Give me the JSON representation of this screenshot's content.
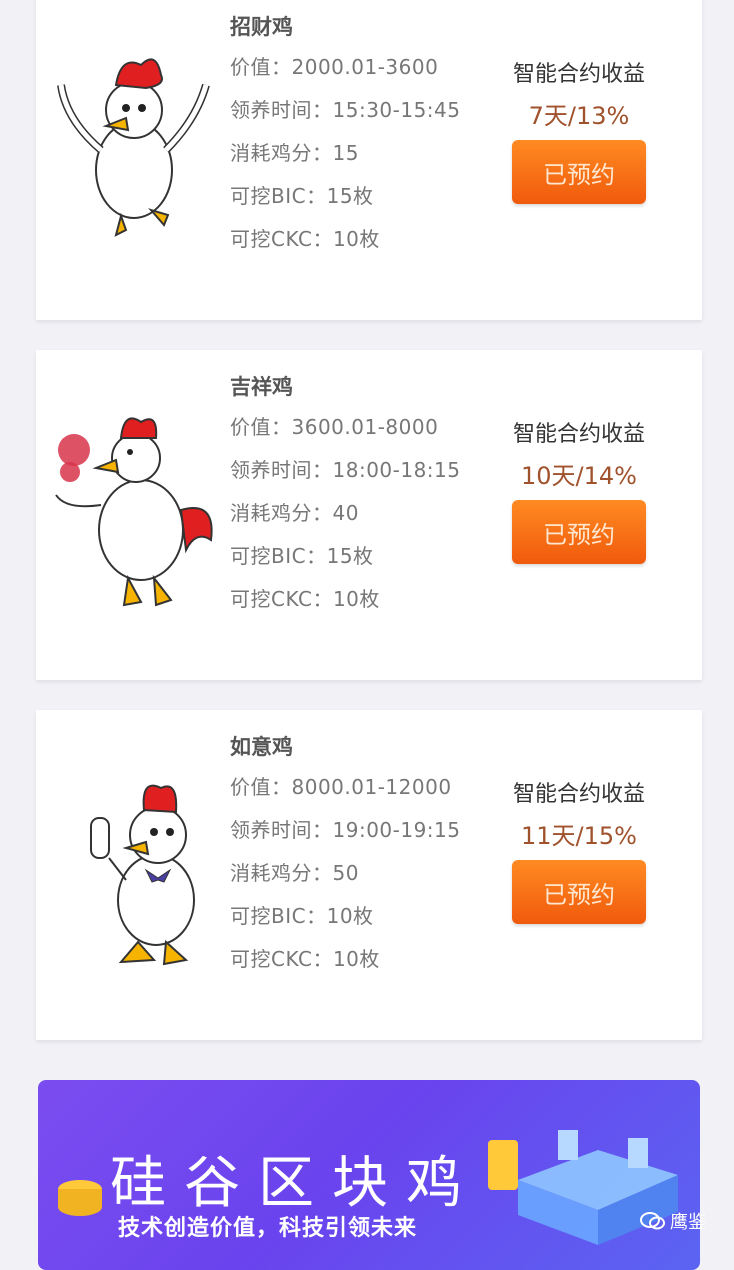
{
  "products": [
    {
      "name": "招财鸡",
      "value_label": "价值：",
      "value": "2000.01-3600",
      "adopt_label": "领养时间：",
      "adopt_time": "15:30-15:45",
      "points_label": "消耗鸡分：",
      "points": "15",
      "bic_label": "可挖BIC：",
      "bic": "15枚",
      "ckc_label": "可挖CKC：",
      "ckc": "10枚",
      "contract_label": "智能合约收益",
      "term": "7天/13%",
      "button_label": "已预约"
    },
    {
      "name": "吉祥鸡",
      "value_label": "价值：",
      "value": "3600.01-8000",
      "adopt_label": "领养时间：",
      "adopt_time": "18:00-18:15",
      "points_label": "消耗鸡分：",
      "points": "40",
      "bic_label": "可挖BIC：",
      "bic": "15枚",
      "ckc_label": "可挖CKC：",
      "ckc": "10枚",
      "contract_label": "智能合约收益",
      "term": "10天/14%",
      "button_label": "已预约"
    },
    {
      "name": "如意鸡",
      "value_label": "价值：",
      "value": "8000.01-12000",
      "adopt_label": "领养时间：",
      "adopt_time": "19:00-19:15",
      "points_label": "消耗鸡分：",
      "points": "50",
      "bic_label": "可挖BIC：",
      "bic": "10枚",
      "ckc_label": "可挖CKC：",
      "ckc": "10枚",
      "contract_label": "智能合约收益",
      "term": "11天/15%",
      "button_label": "已预约"
    }
  ],
  "banner": {
    "title": "硅谷区块鸡",
    "subtitle": "技术创造价值，科技引领未来"
  },
  "watermark": {
    "text": "鹰鉴",
    "icon": "wechat-icon"
  },
  "colors": {
    "accent": "#f47016",
    "term": "#a0522d",
    "banner": "#6a43ee"
  }
}
